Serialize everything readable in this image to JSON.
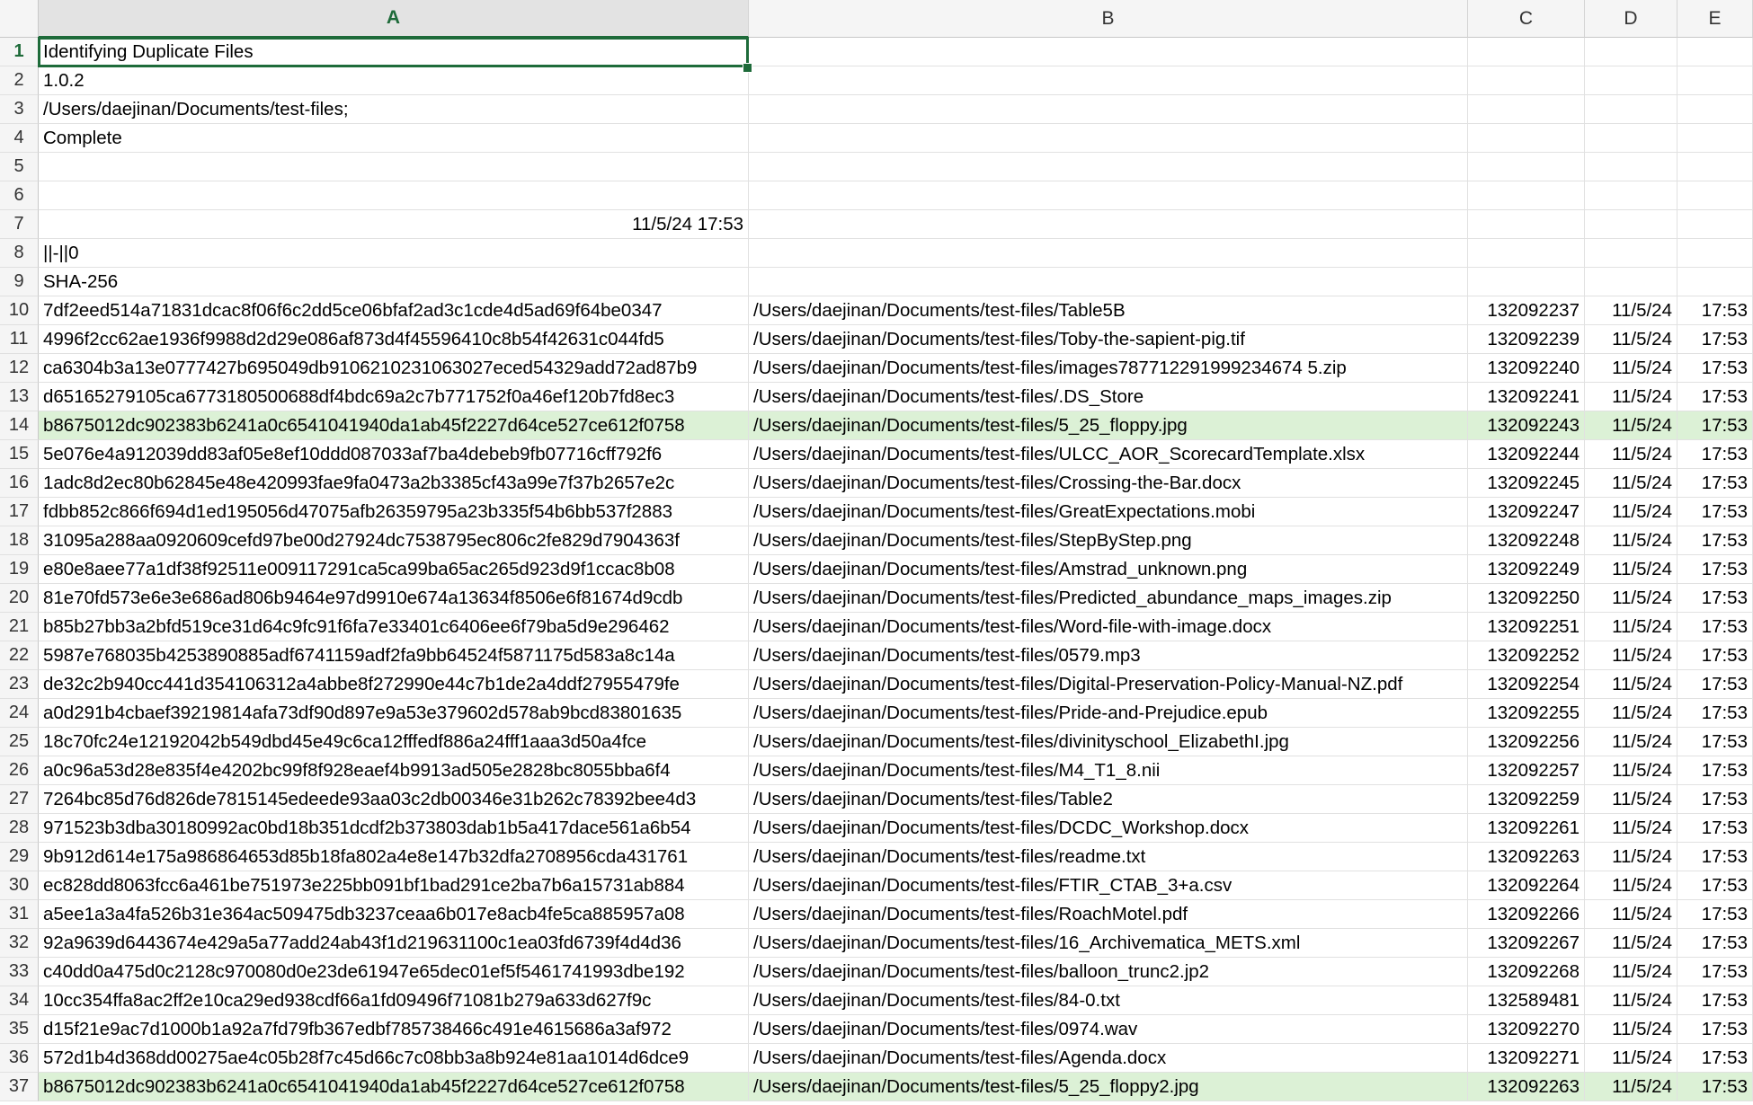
{
  "columns": [
    "A",
    "B",
    "C",
    "D",
    "E"
  ],
  "selected_cell": "A1",
  "rows": [
    {
      "n": "1",
      "a": "Identifying Duplicate Files"
    },
    {
      "n": "2",
      "a": "1.0.2"
    },
    {
      "n": "3",
      "a": "/Users/daejinan/Documents/test-files;"
    },
    {
      "n": "4",
      "a": "Complete"
    },
    {
      "n": "5"
    },
    {
      "n": "6"
    },
    {
      "n": "7",
      "a": "11/5/24 17:53",
      "align_a": "right"
    },
    {
      "n": "8",
      "a": "||-||0"
    },
    {
      "n": "9",
      "a": "SHA-256"
    },
    {
      "n": "10",
      "a": "7df2eed514a71831dcac8f06f6c2dd5ce06bfaf2ad3c1cde4d5ad69f64be0347",
      "b": "/Users/daejinan/Documents/test-files/Table5B",
      "c": "132092237",
      "d": "11/5/24",
      "e": "17:53"
    },
    {
      "n": "11",
      "a": "4996f2cc62ae1936f9988d2d29e086af873d4f45596410c8b54f42631c044fd5",
      "b": "/Users/daejinan/Documents/test-files/Toby-the-sapient-pig.tif",
      "c": "132092239",
      "d": "11/5/24",
      "e": "17:53"
    },
    {
      "n": "12",
      "a": "ca6304b3a13e0777427b695049db9106210231063027eced54329add72ad87b9",
      "b": "/Users/daejinan/Documents/test-files/images787712291999234674 5.zip",
      "c": "132092240",
      "d": "11/5/24",
      "e": "17:53"
    },
    {
      "n": "13",
      "a": "d65165279105ca6773180500688df4bdc69a2c7b771752f0a46ef120b7fd8ec3",
      "b": "/Users/daejinan/Documents/test-files/.DS_Store",
      "c": "132092241",
      "d": "11/5/24",
      "e": "17:53"
    },
    {
      "n": "14",
      "a": "b8675012dc902383b6241a0c6541041940da1ab45f2227d64ce527ce612f0758",
      "b": "/Users/daejinan/Documents/test-files/5_25_floppy.jpg",
      "c": "132092243",
      "d": "11/5/24",
      "e": "17:53",
      "highlight": true
    },
    {
      "n": "15",
      "a": "5e076e4a912039dd83af05e8ef10ddd087033af7ba4debeb9fb07716cff792f6",
      "b": "/Users/daejinan/Documents/test-files/ULCC_AOR_ScorecardTemplate.xlsx",
      "c": "132092244",
      "d": "11/5/24",
      "e": "17:53"
    },
    {
      "n": "16",
      "a": "1adc8d2ec80b62845e48e420993fae9fa0473a2b3385cf43a99e7f37b2657e2c",
      "b": "/Users/daejinan/Documents/test-files/Crossing-the-Bar.docx",
      "c": "132092245",
      "d": "11/5/24",
      "e": "17:53"
    },
    {
      "n": "17",
      "a": "fdbb852c866f694d1ed195056d47075afb26359795a23b335f54b6bb537f2883",
      "b": "/Users/daejinan/Documents/test-files/GreatExpectations.mobi",
      "c": "132092247",
      "d": "11/5/24",
      "e": "17:53"
    },
    {
      "n": "18",
      "a": "31095a288aa0920609cefd97be00d27924dc7538795ec806c2fe829d7904363f",
      "b": "/Users/daejinan/Documents/test-files/StepByStep.png",
      "c": "132092248",
      "d": "11/5/24",
      "e": "17:53"
    },
    {
      "n": "19",
      "a": "e80e8aee77a1df38f92511e009117291ca5ca99ba65ac265d923d9f1ccac8b08",
      "b": "/Users/daejinan/Documents/test-files/Amstrad_unknown.png",
      "c": "132092249",
      "d": "11/5/24",
      "e": "17:53"
    },
    {
      "n": "20",
      "a": "81e70fd573e6e3e686ad806b9464e97d9910e674a13634f8506e6f81674d9cdb",
      "b": "/Users/daejinan/Documents/test-files/Predicted_abundance_maps_images.zip",
      "c": "132092250",
      "d": "11/5/24",
      "e": "17:53"
    },
    {
      "n": "21",
      "a": "b85b27bb3a2bfd519ce31d64c9fc91f6fa7e33401c6406ee6f79ba5d9e296462",
      "b": "/Users/daejinan/Documents/test-files/Word-file-with-image.docx",
      "c": "132092251",
      "d": "11/5/24",
      "e": "17:53"
    },
    {
      "n": "22",
      "a": "5987e768035b4253890885adf6741159adf2fa9bb64524f5871175d583a8c14a",
      "b": "/Users/daejinan/Documents/test-files/0579.mp3",
      "c": "132092252",
      "d": "11/5/24",
      "e": "17:53"
    },
    {
      "n": "23",
      "a": "de32c2b940cc441d354106312a4abbe8f272990e44c7b1de2a4ddf27955479fe",
      "b": "/Users/daejinan/Documents/test-files/Digital-Preservation-Policy-Manual-NZ.pdf",
      "c": "132092254",
      "d": "11/5/24",
      "e": "17:53"
    },
    {
      "n": "24",
      "a": "a0d291b4cbaef39219814afa73df90d897e9a53e379602d578ab9bcd83801635",
      "b": "/Users/daejinan/Documents/test-files/Pride-and-Prejudice.epub",
      "c": "132092255",
      "d": "11/5/24",
      "e": "17:53"
    },
    {
      "n": "25",
      "a": "18c70fc24e12192042b549dbd45e49c6ca12fffedf886a24fff1aaa3d50a4fce",
      "b": "/Users/daejinan/Documents/test-files/divinityschool_ElizabethI.jpg",
      "c": "132092256",
      "d": "11/5/24",
      "e": "17:53"
    },
    {
      "n": "26",
      "a": "a0c96a53d28e835f4e4202bc99f8f928eaef4b9913ad505e2828bc8055bba6f4",
      "b": "/Users/daejinan/Documents/test-files/M4_T1_8.nii",
      "c": "132092257",
      "d": "11/5/24",
      "e": "17:53"
    },
    {
      "n": "27",
      "a": "7264bc85d76d826de7815145edeede93aa03c2db00346e31b262c78392bee4d3",
      "b": "/Users/daejinan/Documents/test-files/Table2",
      "c": "132092259",
      "d": "11/5/24",
      "e": "17:53"
    },
    {
      "n": "28",
      "a": "971523b3dba30180992ac0bd18b351dcdf2b373803dab1b5a417dace561a6b54",
      "b": "/Users/daejinan/Documents/test-files/DCDC_Workshop.docx",
      "c": "132092261",
      "d": "11/5/24",
      "e": "17:53"
    },
    {
      "n": "29",
      "a": "9b912d614e175a986864653d85b18fa802a4e8e147b32dfa2708956cda431761",
      "b": "/Users/daejinan/Documents/test-files/readme.txt",
      "c": "132092263",
      "d": "11/5/24",
      "e": "17:53"
    },
    {
      "n": "30",
      "a": "ec828dd8063fcc6a461be751973e225bb091bf1bad291ce2ba7b6a15731ab884",
      "b": "/Users/daejinan/Documents/test-files/FTIR_CTAB_3+a.csv",
      "c": "132092264",
      "d": "11/5/24",
      "e": "17:53"
    },
    {
      "n": "31",
      "a": "a5ee1a3a4fa526b31e364ac509475db3237ceaa6b017e8acb4fe5ca885957a08",
      "b": "/Users/daejinan/Documents/test-files/RoachMotel.pdf",
      "c": "132092266",
      "d": "11/5/24",
      "e": "17:53"
    },
    {
      "n": "32",
      "a": "92a9639d6443674e429a5a77add24ab43f1d219631100c1ea03fd6739f4d4d36",
      "b": "/Users/daejinan/Documents/test-files/16_Archivematica_METS.xml",
      "c": "132092267",
      "d": "11/5/24",
      "e": "17:53"
    },
    {
      "n": "33",
      "a": "c40dd0a475d0c2128c970080d0e23de61947e65dec01ef5f5461741993dbe192",
      "b": "/Users/daejinan/Documents/test-files/balloon_trunc2.jp2",
      "c": "132092268",
      "d": "11/5/24",
      "e": "17:53"
    },
    {
      "n": "34",
      "a": "10cc354ffa8ac2ff2e10ca29ed938cdf66a1fd09496f71081b279a633d627f9c",
      "b": "/Users/daejinan/Documents/test-files/84-0.txt",
      "c": "132589481",
      "d": "11/5/24",
      "e": "17:53"
    },
    {
      "n": "35",
      "a": "d15f21e9ac7d1000b1a92a7fd79fb367edbf785738466c491e4615686a3af972",
      "b": "/Users/daejinan/Documents/test-files/0974.wav",
      "c": "132092270",
      "d": "11/5/24",
      "e": "17:53"
    },
    {
      "n": "36",
      "a": "572d1b4d368dd00275ae4c05b28f7c45d66c7c08bb3a8b924e81aa1014d6dce9",
      "b": "/Users/daejinan/Documents/test-files/Agenda.docx",
      "c": "132092271",
      "d": "11/5/24",
      "e": "17:53"
    },
    {
      "n": "37",
      "a": "b8675012dc902383b6241a0c6541041940da1ab45f2227d64ce527ce612f0758",
      "b": "/Users/daejinan/Documents/test-files/5_25_floppy2.jpg",
      "c": "132092263",
      "d": "11/5/24",
      "e": "17:53",
      "highlight": true
    }
  ],
  "colors": {
    "selection": "#1e6b3a",
    "highlight_row": "#dcf1d6"
  }
}
